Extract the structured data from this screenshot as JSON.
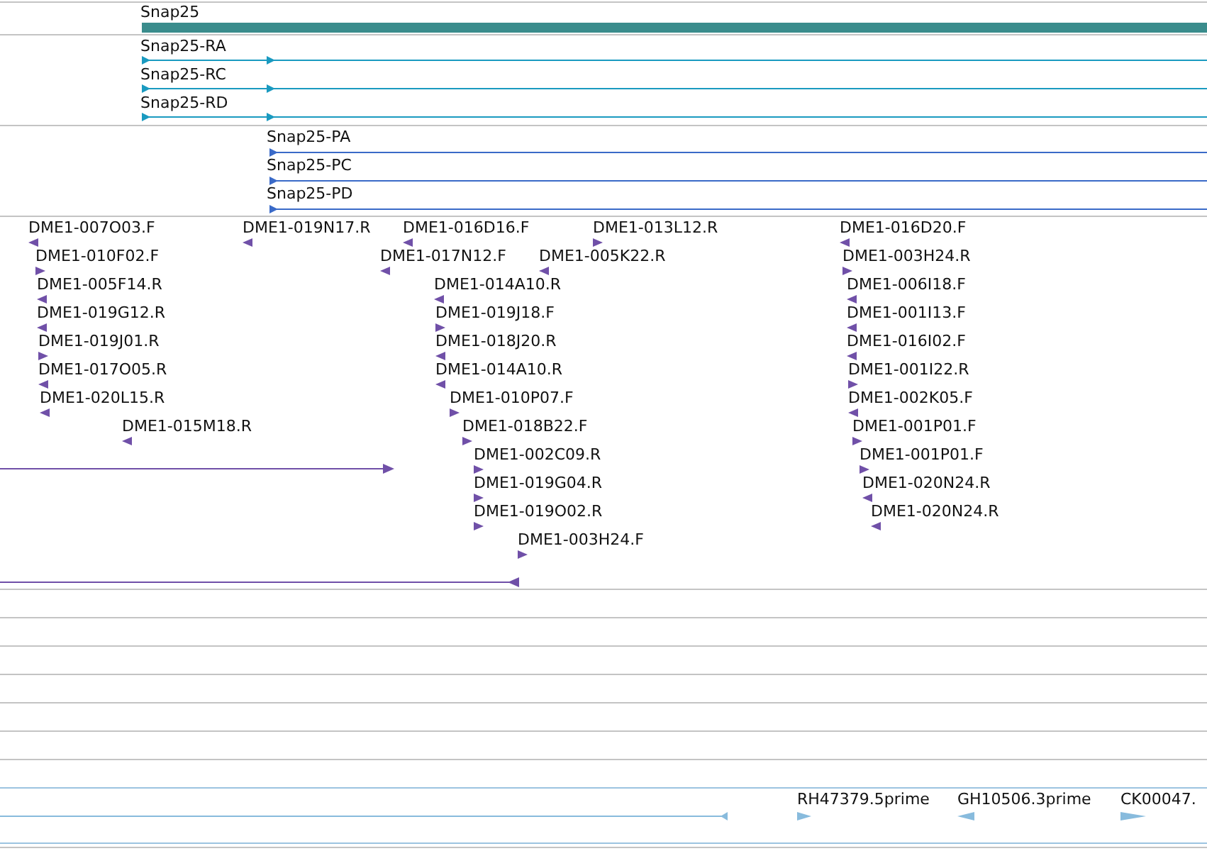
{
  "gene_track": {
    "features": [
      {
        "label": "Snap25"
      }
    ]
  },
  "transcript_track": {
    "features": [
      {
        "label": "Snap25-RA",
        "reverse": false
      },
      {
        "label": "Snap25-RC",
        "reverse": false
      },
      {
        "label": "Snap25-RD",
        "reverse": false
      }
    ]
  },
  "protein_track": {
    "features": [
      {
        "label": "Snap25-PA",
        "reverse": false
      },
      {
        "label": "Snap25-PC",
        "reverse": false
      },
      {
        "label": "Snap25-PD",
        "reverse": false
      }
    ]
  },
  "est_track": {
    "features": [
      {
        "label": "DME1-007O03.F",
        "reverse": true
      },
      {
        "label": "DME1-019N17.R",
        "reverse": true
      },
      {
        "label": "DME1-016D16.F",
        "reverse": true
      },
      {
        "label": "DME1-013L12.R",
        "reverse": false
      },
      {
        "label": "DME1-016D20.F",
        "reverse": true
      },
      {
        "label": "DME1-010F02.F",
        "reverse": false
      },
      {
        "label": "DME1-017N12.F",
        "reverse": true
      },
      {
        "label": "DME1-005K22.R",
        "reverse": true
      },
      {
        "label": "DME1-003H24.R",
        "reverse": false
      },
      {
        "label": "DME1-005F14.R",
        "reverse": true
      },
      {
        "label": "DME1-014A10.R",
        "reverse": true
      },
      {
        "label": "DME1-006I18.F",
        "reverse": true
      },
      {
        "label": "DME1-019G12.R",
        "reverse": true
      },
      {
        "label": "DME1-019J18.F",
        "reverse": false
      },
      {
        "label": "DME1-001I13.F",
        "reverse": true
      },
      {
        "label": "DME1-019J01.R",
        "reverse": false
      },
      {
        "label": "DME1-018J20.R",
        "reverse": true
      },
      {
        "label": "DME1-016I02.F",
        "reverse": true
      },
      {
        "label": "DME1-017O05.R",
        "reverse": true
      },
      {
        "label": "DME1-014A10.R",
        "reverse": true
      },
      {
        "label": "DME1-001I22.R",
        "reverse": false
      },
      {
        "label": "DME1-020L15.R",
        "reverse": true
      },
      {
        "label": "DME1-010P07.F",
        "reverse": false
      },
      {
        "label": "DME1-002K05.F",
        "reverse": true
      },
      {
        "label": "DME1-015M18.R",
        "reverse": true
      },
      {
        "label": "DME1-018B22.F",
        "reverse": false
      },
      {
        "label": "DME1-001P01.F",
        "reverse": false
      },
      {
        "label": "DME1-002C09.R",
        "reverse": false
      },
      {
        "label": "DME1-001P01.F",
        "reverse": false
      },
      {
        "label": "DME1-019G04.R",
        "reverse": false
      },
      {
        "label": "DME1-020N24.R",
        "reverse": true
      },
      {
        "label": "DME1-019O02.R",
        "reverse": false
      },
      {
        "label": "DME1-020N24.R",
        "reverse": true
      },
      {
        "label": "DME1-003H24.F",
        "reverse": false
      }
    ],
    "unlabeled_features": [
      {
        "reverse": false
      },
      {
        "reverse": true
      }
    ]
  },
  "cdna_track": {
    "unlabeled_features": [
      {
        "reverse": true
      }
    ],
    "features": [
      {
        "label": "RH47379.5prime",
        "reverse": false
      },
      {
        "label": "GH10506.3prime",
        "reverse": true
      },
      {
        "label": "CK00047.",
        "reverse": false
      }
    ]
  }
}
